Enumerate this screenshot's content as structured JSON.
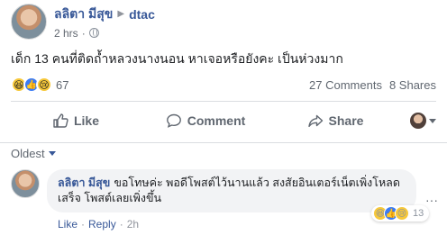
{
  "post": {
    "author": "ลลิตา มีสุข",
    "target": "dtac",
    "time": "2 hrs",
    "text": "เด็ก 13 คนที่ติดถ้ำหลวงนางนอน หาเจอหรือยังคะ เป็นห่วงมาก",
    "reaction_icons": [
      "haha-icon",
      "like-icon",
      "sad-icon"
    ],
    "reaction_count": "67",
    "comments_count": "27 Comments",
    "shares_count": "8 Shares"
  },
  "actions": {
    "like": "Like",
    "comment": "Comment",
    "share": "Share"
  },
  "comments_section": {
    "sort_label": "Oldest"
  },
  "comment": {
    "author": "ลลิตา มีสุข",
    "text": "ขอโทษค่ะ พอดีโพสต์ไว้นานแล้ว สงสัยอินเตอร์เน็ตเพิ่งโหลดเสร็จ โพสต์เลยเพิ่งขึ้น",
    "like_label": "Like",
    "reply_label": "Reply",
    "time": "2h",
    "reaction_count": "13",
    "reaction_icons": [
      "haha-icon",
      "like-icon",
      "sad-icon"
    ]
  },
  "colors": {
    "link_blue": "#385898",
    "meta_gray": "#616770",
    "divider": "#dadde1",
    "bubble_bg": "#f2f3f5"
  }
}
